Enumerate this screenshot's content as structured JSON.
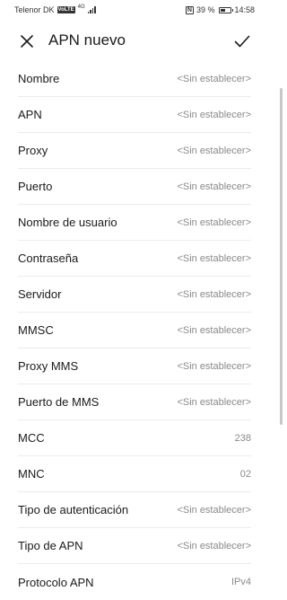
{
  "status_bar": {
    "carrier": "Telenor DK",
    "volte": "VoLTE",
    "network": "4G",
    "battery_percent": "39 %",
    "battery_level": 0.39,
    "time": "14:58"
  },
  "app_bar": {
    "title": "APN nuevo"
  },
  "icons": {
    "close": "close-icon",
    "save": "check-icon"
  },
  "fields": [
    {
      "label": "Nombre",
      "value": "<Sin establecer>"
    },
    {
      "label": "APN",
      "value": "<Sin establecer>"
    },
    {
      "label": "Proxy",
      "value": "<Sin establecer>"
    },
    {
      "label": "Puerto",
      "value": "<Sin establecer>"
    },
    {
      "label": "Nombre de usuario",
      "value": "<Sin establecer>"
    },
    {
      "label": "Contraseña",
      "value": "<Sin establecer>"
    },
    {
      "label": "Servidor",
      "value": "<Sin establecer>"
    },
    {
      "label": "MMSC",
      "value": "<Sin establecer>"
    },
    {
      "label": "Proxy MMS",
      "value": "<Sin establecer>"
    },
    {
      "label": "Puerto de MMS",
      "value": "<Sin establecer>"
    },
    {
      "label": "MCC",
      "value": "238"
    },
    {
      "label": "MNC",
      "value": "02"
    },
    {
      "label": "Tipo de autenticación",
      "value": "<Sin establecer>"
    },
    {
      "label": "Tipo de APN",
      "value": "<Sin establecer>"
    },
    {
      "label": "Protocolo APN",
      "value": "IPv4"
    }
  ]
}
